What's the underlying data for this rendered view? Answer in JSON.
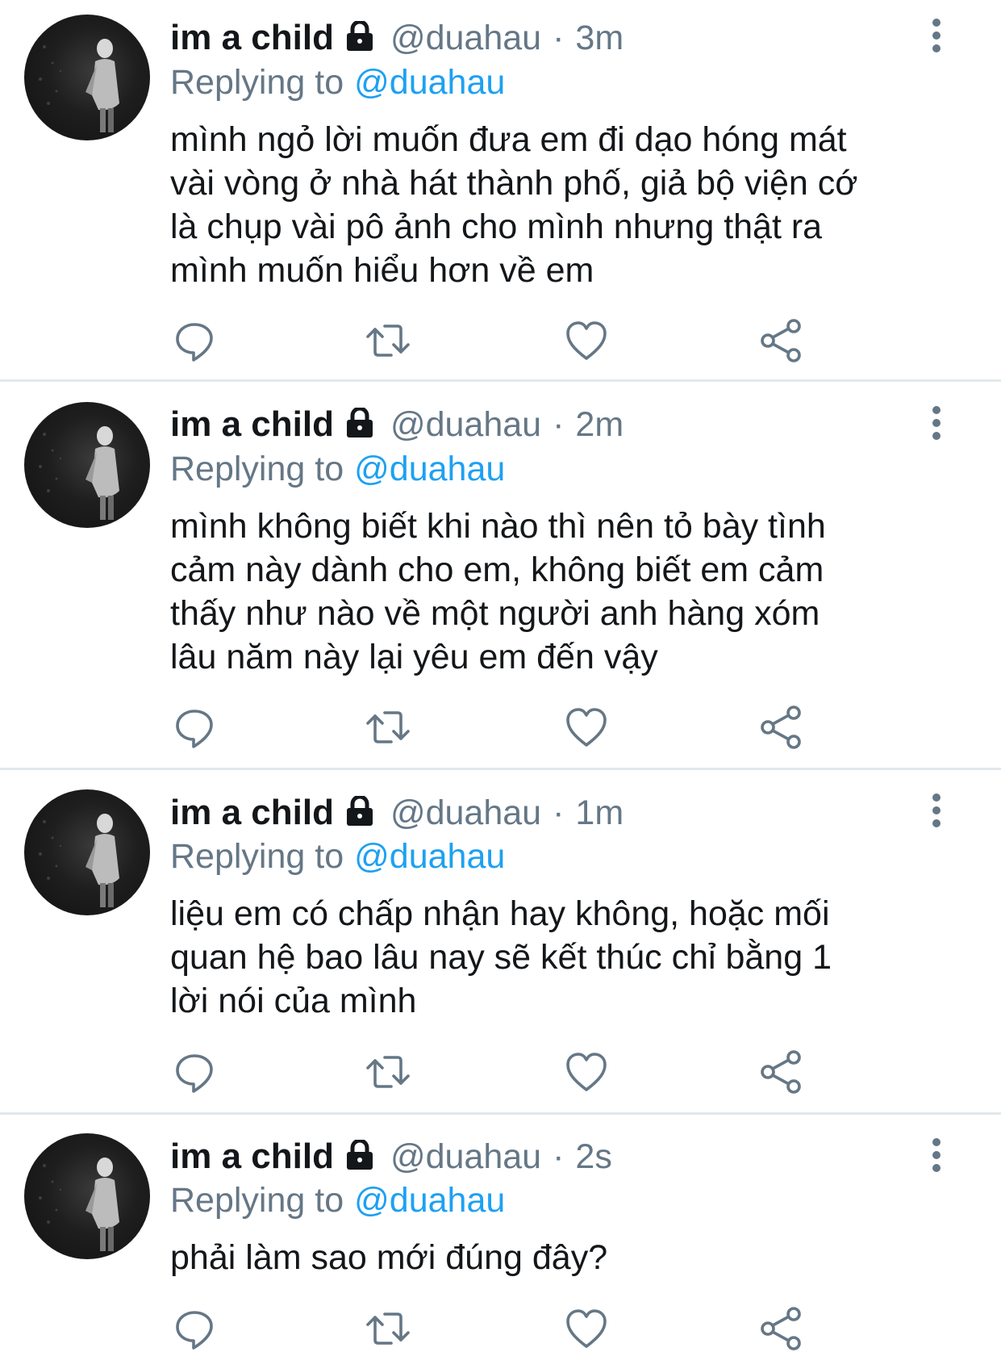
{
  "tweets": [
    {
      "name": "im a child",
      "handle": "@duahau",
      "dot": "·",
      "time": "3m",
      "replying_prefix": "Replying to",
      "replying_to": "@duahau",
      "text": "mình ngỏ lời muốn đưa em đi dạo hóng mát\nvài vòng ở nhà hát thành phố, giả bộ viện cớ\nlà chụp vài pô ảnh cho mình nhưng thật ra\nmình muốn hiểu hơn về em"
    },
    {
      "name": "im a child",
      "handle": "@duahau",
      "dot": "·",
      "time": "2m",
      "replying_prefix": "Replying to",
      "replying_to": "@duahau",
      "text": "mình không biết khi nào thì nên tỏ bày tình\ncảm này dành cho em, không biết em cảm\nthấy như nào về một người anh hàng xóm\nlâu năm này lại yêu em đến vậy"
    },
    {
      "name": "im a child",
      "handle": "@duahau",
      "dot": "·",
      "time": "1m",
      "replying_prefix": "Replying to",
      "replying_to": "@duahau",
      "text": "liệu em có chấp nhận hay không, hoặc mối\nquan hệ bao lâu nay sẽ kết thúc chỉ bằng 1\nlời nói của mình"
    },
    {
      "name": "im a child",
      "handle": "@duahau",
      "dot": "·",
      "time": "2s",
      "replying_prefix": "Replying to",
      "replying_to": "@duahau",
      "text": "phải làm sao mới đúng đây?"
    }
  ],
  "icons": {
    "protected": "lock-icon",
    "more": "more-vertical-icon",
    "reply": "reply-icon",
    "retweet": "retweet-icon",
    "like": "heart-icon",
    "share": "share-icon"
  },
  "colors": {
    "text": "#14171a",
    "secondary": "#657786",
    "link": "#1da1f2",
    "divider": "#e1e8ed"
  }
}
